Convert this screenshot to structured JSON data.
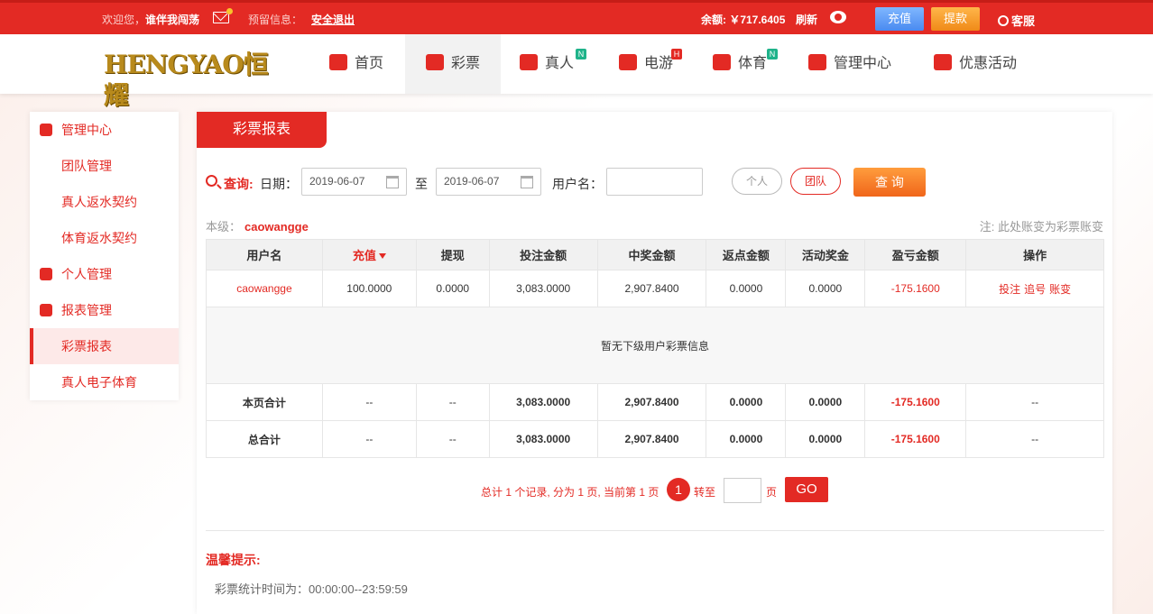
{
  "topbar": {
    "welcome_prefix": "欢迎您，",
    "username": "谁伴我闯荡",
    "notice_label": "预留信息：",
    "logout_label": "安全退出",
    "balance_text": "余额: ￥717.6405",
    "refresh_label": "刷新",
    "recharge_label": "充值",
    "withdraw_label": "提款",
    "service_label": "客服"
  },
  "brand": {
    "logo_text": "HENGYAO恒耀"
  },
  "nav": {
    "items": [
      {
        "label": "首页",
        "icon": "home-icon"
      },
      {
        "label": "彩票",
        "icon": "lottery-icon"
      },
      {
        "label": "真人",
        "icon": "live-dealer-icon",
        "badge": "N"
      },
      {
        "label": "电游",
        "icon": "slot-game-icon",
        "badge": "H"
      },
      {
        "label": "体育",
        "icon": "trophy-icon",
        "badge": "N"
      },
      {
        "label": "管理中心",
        "icon": "users-icon"
      },
      {
        "label": "优惠活动",
        "icon": "gift-icon"
      }
    ]
  },
  "sidebar": {
    "items": [
      {
        "label": "管理中心",
        "type": "group",
        "icon": "users-icon"
      },
      {
        "label": "团队管理",
        "type": "child"
      },
      {
        "label": "真人返水契约",
        "type": "child"
      },
      {
        "label": "体育返水契约",
        "type": "child"
      },
      {
        "label": "个人管理",
        "type": "group",
        "icon": "user-icon"
      },
      {
        "label": "报表管理",
        "type": "group",
        "icon": "report-icon"
      },
      {
        "label": "彩票报表",
        "type": "child",
        "active": true
      },
      {
        "label": "真人电子体育",
        "type": "child"
      }
    ]
  },
  "main": {
    "tab_label": "彩票报表",
    "search": {
      "query_label": "查询:",
      "date_label": "日期：",
      "date_from": "2019-06-07",
      "to_label": "至",
      "date_to": "2019-06-07",
      "username_label": "用户名：",
      "username_value": "",
      "personal_label": "个人",
      "team_label": "团队",
      "submit_label": "查 询"
    },
    "level_label": "本级：",
    "level_user": "caowangge",
    "note": "注: 此处账变为彩票账变",
    "table": {
      "headers": [
        "用户名",
        "充值",
        "提现",
        "投注金额",
        "中奖金额",
        "返点金额",
        "活动奖金",
        "盈亏金额",
        "操作"
      ],
      "row": {
        "user": "caowangge",
        "recharge": "100.0000",
        "withdraw": "0.0000",
        "bet": "3,083.0000",
        "win": "2,907.8400",
        "rebate": "0.0000",
        "bonus": "0.0000",
        "profit": "-175.1600",
        "ops": [
          "投注",
          "追号",
          "账变"
        ]
      },
      "empty_text": "暂无下级用户彩票信息",
      "page_total": {
        "label": "本页合计",
        "recharge": "--",
        "withdraw": "--",
        "bet": "3,083.0000",
        "win": "2,907.8400",
        "rebate": "0.0000",
        "bonus": "0.0000",
        "profit": "-175.1600",
        "ops": "--"
      },
      "grand_total": {
        "label": "总合计",
        "recharge": "--",
        "withdraw": "--",
        "bet": "3,083.0000",
        "win": "2,907.8400",
        "rebate": "0.0000",
        "bonus": "0.0000",
        "profit": "-175.1600",
        "ops": "--"
      }
    },
    "pager": {
      "summary": "总计 1 个记录, 分为 1 页, 当前第 1 页",
      "current_page": "1",
      "jump_label": "转至",
      "page_unit": "页",
      "go_label": "GO"
    },
    "tips": {
      "title": "温馨提示:",
      "text": "彩票统计时间为：00:00:00--23:59:59"
    }
  },
  "colors": {
    "primary": "#e32a24",
    "accent_orange": "#f0651a",
    "recharge_blue": "#4a8af0"
  }
}
